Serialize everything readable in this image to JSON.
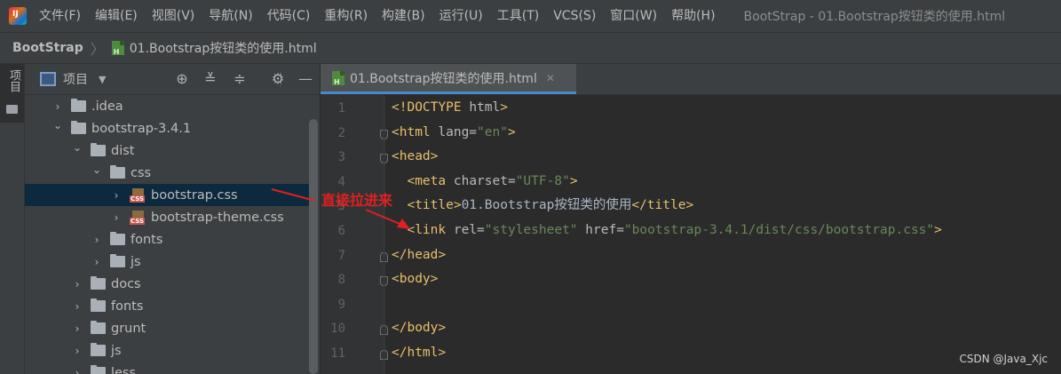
{
  "menubar": {
    "items": [
      "文件(F)",
      "编辑(E)",
      "视图(V)",
      "导航(N)",
      "代码(C)",
      "重构(R)",
      "构建(B)",
      "运行(U)",
      "工具(T)",
      "VCS(S)",
      "窗口(W)",
      "帮助(H)"
    ],
    "window_title": "BootStrap - 01.Bootstrap按钮类的使用.html"
  },
  "breadcrumb": {
    "project": "BootStrap",
    "separator": "〉",
    "file": "01.Bootstrap按钮类的使用.html"
  },
  "tool_strip": {
    "project_tab_label": "项目"
  },
  "project_panel": {
    "title": "项目",
    "dropdown_icon": "chevron-down-icon",
    "header_icons": [
      "locate-icon",
      "expand-all-icon",
      "collapse-all-icon",
      "gear-icon",
      "minimize-icon"
    ],
    "tree": [
      {
        "label": ".idea",
        "type": "folder",
        "expanded": false,
        "selected": false
      },
      {
        "label": "bootstrap-3.4.1",
        "type": "folder",
        "expanded": true,
        "selected": false
      },
      {
        "label": "dist",
        "type": "folder",
        "expanded": true,
        "selected": false
      },
      {
        "label": "css",
        "type": "folder",
        "expanded": true,
        "selected": false
      },
      {
        "label": "bootstrap.css",
        "type": "css",
        "expanded": false,
        "selected": true
      },
      {
        "label": "bootstrap-theme.css",
        "type": "css",
        "expanded": false,
        "selected": false
      },
      {
        "label": "fonts",
        "type": "folder",
        "expanded": false,
        "selected": false
      },
      {
        "label": "js",
        "type": "folder",
        "expanded": false,
        "selected": false
      },
      {
        "label": "docs",
        "type": "folder",
        "expanded": false,
        "selected": false
      },
      {
        "label": "fonts",
        "type": "folder",
        "expanded": false,
        "selected": false
      },
      {
        "label": "grunt",
        "type": "folder",
        "expanded": false,
        "selected": false
      },
      {
        "label": "js",
        "type": "folder",
        "expanded": false,
        "selected": false
      },
      {
        "label": "less",
        "type": "folder",
        "expanded": false,
        "selected": false
      }
    ]
  },
  "editor": {
    "tab_label": "01.Bootstrap按钮类的使用.html",
    "tab_close": "✕",
    "line_numbers": [
      "1",
      "2",
      "3",
      "4",
      "5",
      "6",
      "7",
      "8",
      "9",
      "10",
      "11"
    ],
    "lines": [
      [
        [
          "tag",
          "<!DOCTYPE "
        ],
        [
          "attr",
          "html"
        ],
        [
          "tag",
          ">"
        ]
      ],
      [
        [
          "tag",
          "<html "
        ],
        [
          "attr",
          "lang="
        ],
        [
          "val",
          "\"en\""
        ],
        [
          "tag",
          ">"
        ]
      ],
      [
        [
          "tag",
          "<head>"
        ]
      ],
      [
        [
          "text",
          "  "
        ],
        [
          "tag",
          "<meta "
        ],
        [
          "attr",
          "charset="
        ],
        [
          "val",
          "\"UTF-8\""
        ],
        [
          "tag",
          ">"
        ]
      ],
      [
        [
          "text",
          "  "
        ],
        [
          "tag",
          "<title>"
        ],
        [
          "text",
          "01.Bootstrap"
        ],
        [
          "cjk",
          "按钮类的使用"
        ],
        [
          "tag",
          "</title>"
        ]
      ],
      [
        [
          "text",
          "  "
        ],
        [
          "tag",
          "<link "
        ],
        [
          "attr",
          "rel="
        ],
        [
          "val",
          "\"stylesheet\""
        ],
        [
          "attr",
          " href="
        ],
        [
          "val",
          "\"bootstrap-3.4.1/dist/css/bootstrap.css\""
        ],
        [
          "tag",
          ">"
        ]
      ],
      [
        [
          "tag",
          "</head>"
        ]
      ],
      [
        [
          "tag",
          "<body>"
        ]
      ],
      [],
      [
        [
          "tag",
          "</body>"
        ]
      ],
      [
        [
          "tag",
          "</html>"
        ]
      ]
    ]
  },
  "annotation": {
    "text": "直接拉进来",
    "color": "#e02020"
  },
  "watermark": "CSDN @Java_Xjc",
  "colors": {
    "tag": "#e8bf6a",
    "attr": "#bababa",
    "val": "#6a8759",
    "text": "#a9b7c6",
    "selection": "#0d293e",
    "accent": "#4a88c7"
  }
}
